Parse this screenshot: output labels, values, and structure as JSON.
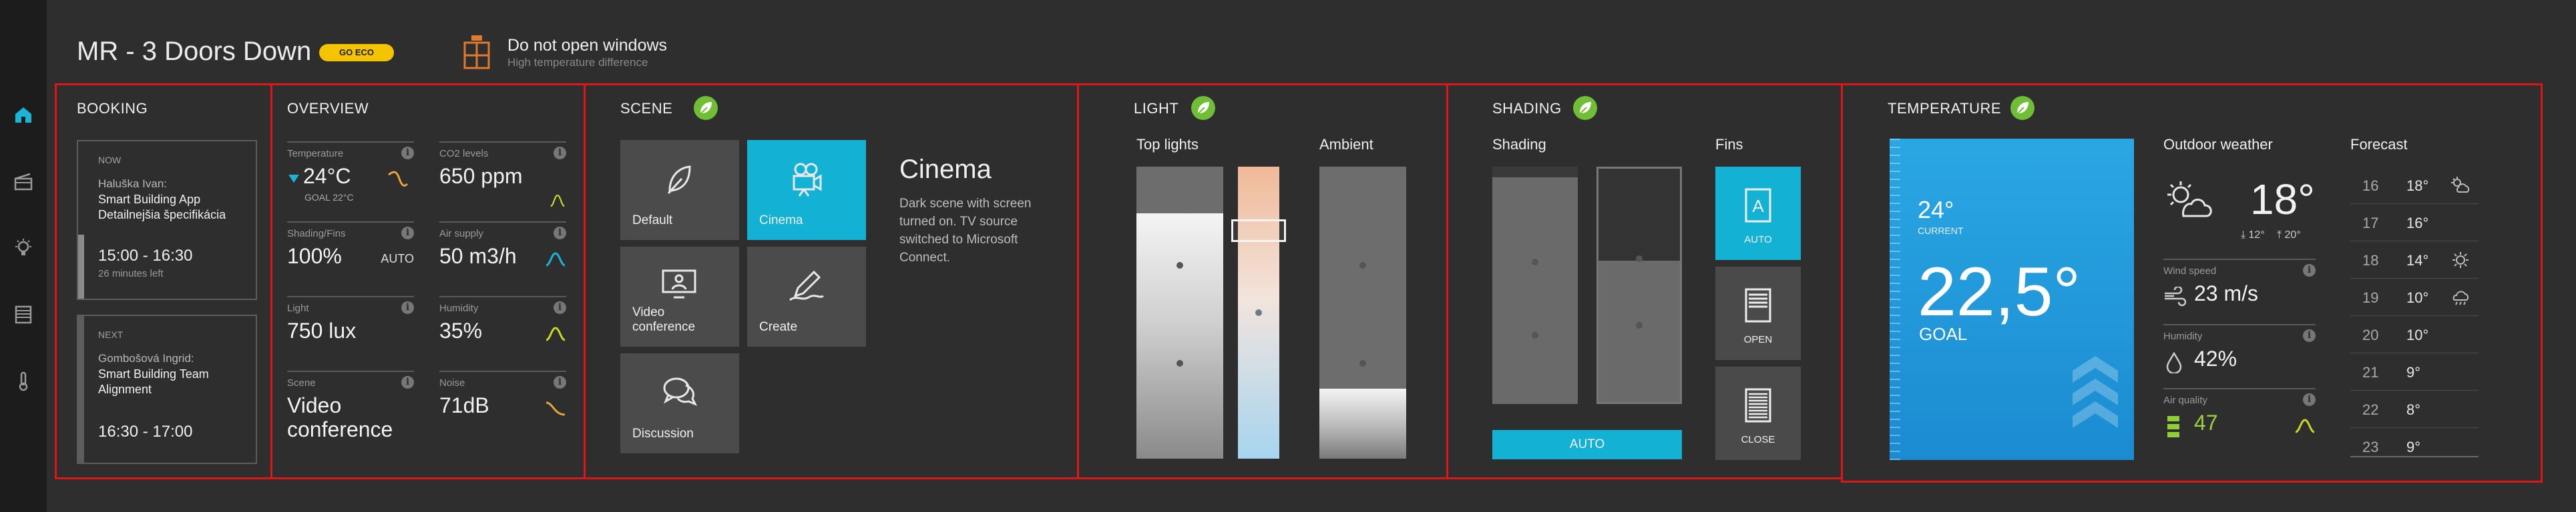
{
  "header": {
    "title": "MR - 3 Doors Down",
    "eco_badge": "GO ECO",
    "alert_title": "Do not open windows",
    "alert_subtitle": "High temperature difference"
  },
  "rail": {
    "icons": [
      "home-icon",
      "scene-icon",
      "light-icon",
      "shading-icon",
      "temperature-icon"
    ],
    "active": "home-icon"
  },
  "booking": {
    "title": "BOOKING",
    "now": {
      "tag": "NOW",
      "name": "Haluška Ivan:",
      "desc": "Smart Building App Detailnejšia špecifikácia",
      "time": "15:00 - 16:30",
      "left": "26 minutes left"
    },
    "next": {
      "tag": "NEXT",
      "name": "Gombošová Ingrid:",
      "desc": "Smart Building Team Alignment",
      "time": "16:30 - 17:00"
    }
  },
  "overview": {
    "title": "OVERVIEW",
    "temperature": {
      "label": "Temperature",
      "value": "24°C",
      "goal": "GOAL 22°C"
    },
    "co2": {
      "label": "CO2 levels",
      "value": "650 ppm"
    },
    "shading": {
      "label": "Shading/Fins",
      "value": "100%",
      "mode": "AUTO"
    },
    "air_supply": {
      "label": "Air supply",
      "value": "50 m3/h"
    },
    "light": {
      "label": "Light",
      "value": "750 lux"
    },
    "humidity": {
      "label": "Humidity",
      "value": "35%"
    },
    "scene": {
      "label": "Scene",
      "value": "Video conference"
    },
    "noise": {
      "label": "Noise",
      "value": "71dB"
    },
    "info": "i"
  },
  "scene": {
    "title": "SCENE",
    "tiles": [
      {
        "label": "Default"
      },
      {
        "label": "Cinema"
      },
      {
        "label": "Video conference"
      },
      {
        "label": "Create"
      },
      {
        "label": "Discussion"
      }
    ],
    "active_name": "Cinema",
    "description": "Dark scene with screen turned on. TV source switched to Microsoft Connect."
  },
  "light": {
    "title": "LIGHT",
    "top_label": "Top lights",
    "ambient_label": "Ambient",
    "top_level": 0.84,
    "ambient_level": 0.24
  },
  "shading": {
    "title": "SHADING",
    "shading_label": "Shading",
    "fins_label": "Fins",
    "auto_label": "AUTO",
    "fins": [
      {
        "label": "AUTO"
      },
      {
        "label": "OPEN"
      },
      {
        "label": "CLOSE"
      }
    ]
  },
  "temperature": {
    "title": "TEMPERATURE",
    "current": "24°",
    "current_label": "CURRENT",
    "goal": "22,5°",
    "goal_label": "GOAL",
    "outdoor_title": "Outdoor weather",
    "outdoor_temp": "18°",
    "outdoor_low": "12°",
    "outdoor_high": "20°",
    "wind": {
      "label": "Wind speed",
      "value": "23 m/s"
    },
    "humidity": {
      "label": "Humidity",
      "value": "42%"
    },
    "air_quality": {
      "label": "Air quality",
      "value": "47"
    },
    "forecast_title": "Forecast",
    "forecast": [
      {
        "hour": "16",
        "temp": "18°",
        "icon": "cloud-sun-icon"
      },
      {
        "hour": "17",
        "temp": "16°",
        "icon": ""
      },
      {
        "hour": "18",
        "temp": "14°",
        "icon": "sun-icon"
      },
      {
        "hour": "19",
        "temp": "10°",
        "icon": "cloud-rain-icon"
      },
      {
        "hour": "20",
        "temp": "10°",
        "icon": ""
      },
      {
        "hour": "21",
        "temp": "9°",
        "icon": ""
      },
      {
        "hour": "22",
        "temp": "8°",
        "icon": ""
      },
      {
        "hour": "23",
        "temp": "9°",
        "icon": ""
      }
    ]
  },
  "colors": {
    "accent": "#13b2d4",
    "eco": "#f5c400",
    "alert": "#e07a2e",
    "leaf": "#6fbe36",
    "border": "#e01616"
  }
}
